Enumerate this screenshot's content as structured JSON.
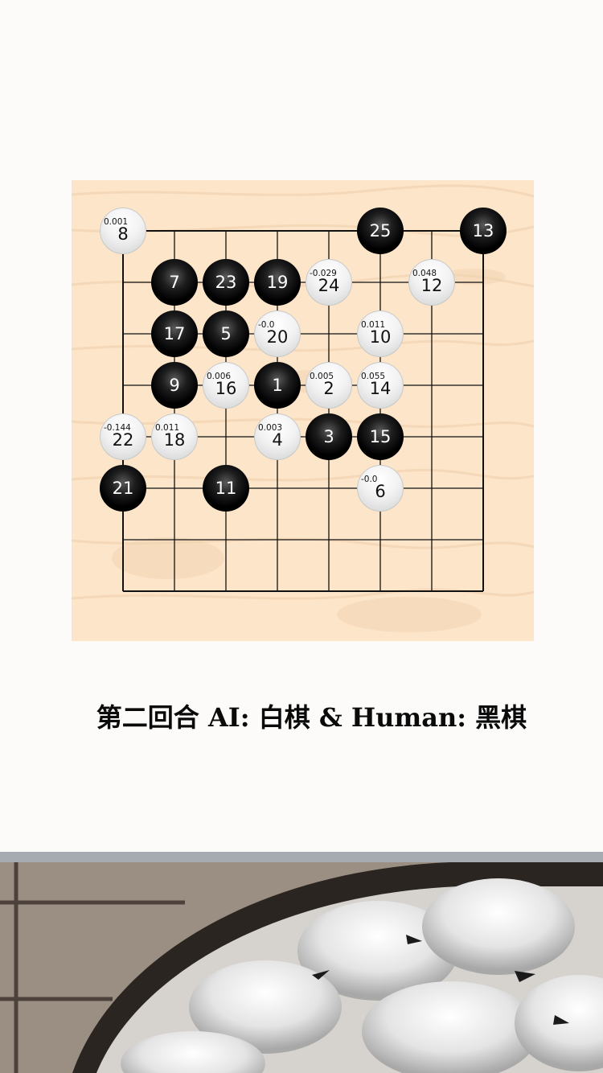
{
  "caption": "第二回合 AI: 白棋 & Human: 黑棋",
  "colors": {
    "board": "#fde5c9",
    "grid_line": "#111111",
    "black_stone": "#000000",
    "white_stone": "#f0f0f0",
    "bottom_strip": "#a6aab1"
  },
  "board": {
    "columns": 8,
    "rows": 8,
    "stones": [
      {
        "num": "1",
        "color": "black",
        "col": 3,
        "row": 3,
        "score": ""
      },
      {
        "num": "2",
        "color": "white",
        "col": 4,
        "row": 3,
        "score": "0.005"
      },
      {
        "num": "3",
        "color": "black",
        "col": 4,
        "row": 4,
        "score": ""
      },
      {
        "num": "4",
        "color": "white",
        "col": 3,
        "row": 4,
        "score": "0.003"
      },
      {
        "num": "5",
        "color": "black",
        "col": 2,
        "row": 2,
        "score": ""
      },
      {
        "num": "6",
        "color": "white",
        "col": 5,
        "row": 5,
        "score": "-0.0"
      },
      {
        "num": "7",
        "color": "black",
        "col": 1,
        "row": 1,
        "score": ""
      },
      {
        "num": "8",
        "color": "white",
        "col": 0,
        "row": 0,
        "score": "0.001"
      },
      {
        "num": "9",
        "color": "black",
        "col": 1,
        "row": 3,
        "score": ""
      },
      {
        "num": "10",
        "color": "white",
        "col": 5,
        "row": 2,
        "score": "0.011"
      },
      {
        "num": "11",
        "color": "black",
        "col": 2,
        "row": 5,
        "score": ""
      },
      {
        "num": "12",
        "color": "white",
        "col": 6,
        "row": 1,
        "score": "0.048"
      },
      {
        "num": "13",
        "color": "black",
        "col": 7,
        "row": 0,
        "score": ""
      },
      {
        "num": "14",
        "color": "white",
        "col": 5,
        "row": 3,
        "score": "0.055"
      },
      {
        "num": "15",
        "color": "black",
        "col": 5,
        "row": 4,
        "score": ""
      },
      {
        "num": "16",
        "color": "white",
        "col": 2,
        "row": 3,
        "score": "0.006"
      },
      {
        "num": "17",
        "color": "black",
        "col": 1,
        "row": 2,
        "score": ""
      },
      {
        "num": "18",
        "color": "white",
        "col": 1,
        "row": 4,
        "score": "0.011"
      },
      {
        "num": "19",
        "color": "black",
        "col": 3,
        "row": 1,
        "score": ""
      },
      {
        "num": "20",
        "color": "white",
        "col": 3,
        "row": 2,
        "score": "-0.0"
      },
      {
        "num": "21",
        "color": "black",
        "col": 0,
        "row": 5,
        "score": ""
      },
      {
        "num": "22",
        "color": "white",
        "col": 0,
        "row": 4,
        "score": "-0.144"
      },
      {
        "num": "23",
        "color": "black",
        "col": 2,
        "row": 1,
        "score": ""
      },
      {
        "num": "24",
        "color": "white",
        "col": 4,
        "row": 1,
        "score": "-0.029"
      },
      {
        "num": "25",
        "color": "black",
        "col": 5,
        "row": 0,
        "score": ""
      }
    ]
  }
}
